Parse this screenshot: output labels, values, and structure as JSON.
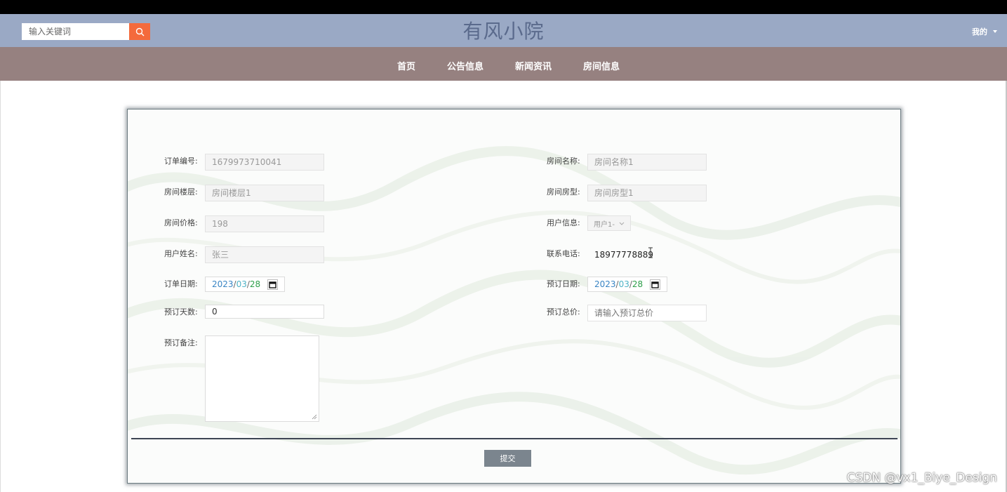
{
  "header": {
    "search_placeholder": "输入关键词",
    "site_title": "有风小院",
    "user_menu_label": "我的"
  },
  "nav": {
    "items": [
      "首页",
      "公告信息",
      "新闻资讯",
      "房间信息"
    ]
  },
  "form": {
    "order_no": {
      "label": "订单编号:",
      "value": "1679973710041"
    },
    "room_name": {
      "label": "房间名称:",
      "value": "房间名称1"
    },
    "room_floor": {
      "label": "房间楼层:",
      "value": "房间楼层1"
    },
    "room_type": {
      "label": "房间房型:",
      "value": "房间房型1"
    },
    "room_price": {
      "label": "房间价格:",
      "value": "198"
    },
    "user_info": {
      "label": "用户信息:",
      "value": "用户1-"
    },
    "user_name": {
      "label": "用户姓名:",
      "value": "张三"
    },
    "phone": {
      "label": "联系电话:",
      "value": "18977778889"
    },
    "order_date": {
      "label": "订单日期:",
      "year": "2023",
      "month": "03",
      "day": "28",
      "sep": "/"
    },
    "book_date": {
      "label": "预订日期:",
      "year": "2023",
      "month": "03",
      "day": "28",
      "sep": "/"
    },
    "book_days": {
      "label": "预订天数:",
      "value": "0"
    },
    "total_price": {
      "label": "预订总价:",
      "placeholder": "请输入预订总价"
    },
    "remark": {
      "label": "预订备注:"
    },
    "submit_label": "提交"
  },
  "watermark": "CSDN @vx1_Biye_Design",
  "colors": {
    "header_bg": "#9aa9c5",
    "nav_bg": "#968180",
    "search_button": "#f46a3c",
    "submit_button": "#7b858e"
  },
  "icons": {
    "search": "search-icon",
    "calendar": "calendar-icon",
    "dropdown": "chevron-down-icon",
    "user_caret": "caret-down-icon",
    "text_cursor": "text-cursor-icon"
  }
}
